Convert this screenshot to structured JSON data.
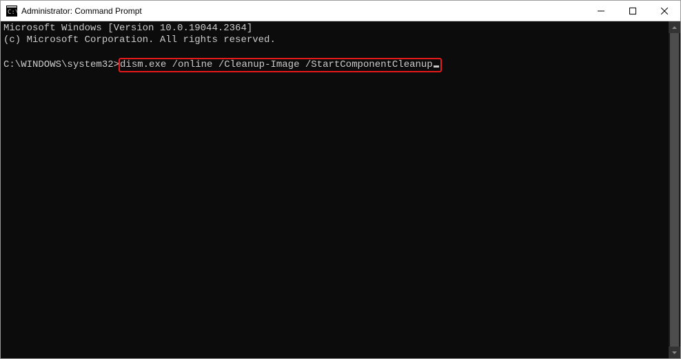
{
  "window": {
    "title": "Administrator: Command Prompt"
  },
  "terminal": {
    "line1": "Microsoft Windows [Version 10.0.19044.2364]",
    "line2": "(c) Microsoft Corporation. All rights reserved.",
    "prompt": "C:\\WINDOWS\\system32>",
    "command": "dism.exe /online /Cleanup-Image /StartComponentCleanup"
  }
}
